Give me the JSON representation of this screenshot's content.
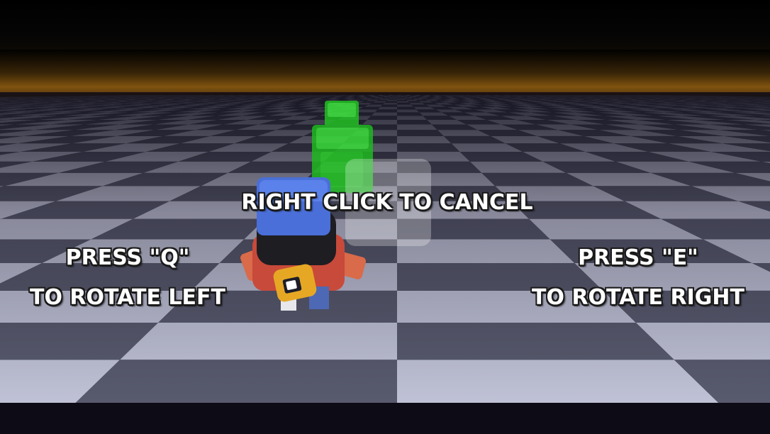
{
  "hud": {
    "cancel_hint": "RIGHT CLICK TO CANCEL",
    "rotate_left_line1": "PRESS \"Q\"",
    "rotate_left_line2": "TO ROTATE LEFT",
    "rotate_right_line1": "PRESS \"E\"",
    "rotate_right_line2": "TO ROTATE RIGHT"
  },
  "colors": {
    "ghost_preview": "#2bd62b",
    "player_cap": "#4a6fd8",
    "floor_light": "#c9cbe0",
    "floor_dark": "#5c5e72",
    "horizon_glow": "#8a5a0e"
  }
}
